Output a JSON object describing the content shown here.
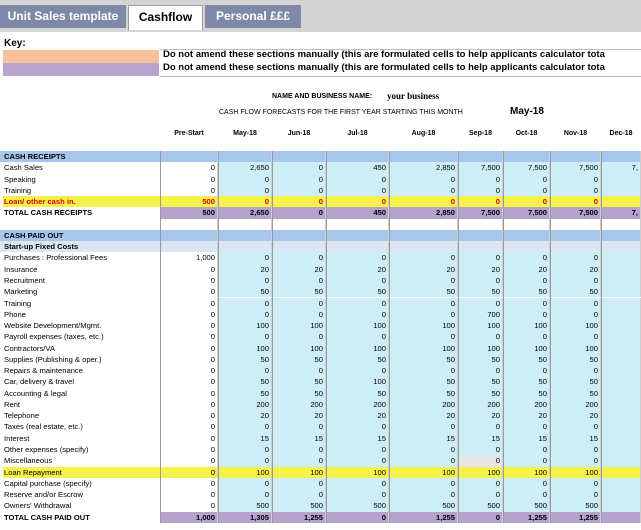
{
  "tabs": [
    {
      "label": "Unit Sales template",
      "state": "inactive"
    },
    {
      "label": "Cashflow",
      "state": "active"
    },
    {
      "label": "Personal £££",
      "state": "inactive"
    }
  ],
  "key": {
    "title": "Key:",
    "items": [
      {
        "color": "#f8c09a",
        "text": "Do not amend these  sections manually (this are formulated cells to help applicants calculator tota"
      },
      {
        "color": "#b7a5cf",
        "text": "Do not amend these  sections manually (this are formulated cells to help applicants calculator tota"
      }
    ]
  },
  "header": {
    "name_label": "NAME AND BUSINESS NAME:",
    "name_value": "your business",
    "forecast_label": "CASH FLOW FORECASTS FOR THE FIRST YEAR STARTING THIS MONTH",
    "start_month": "May-18"
  },
  "columns": [
    "Pre-Start",
    "May-18",
    "Jun-18",
    "Jul-18",
    "Aug-18",
    "Sep-18",
    "Oct-18",
    "Nov-18",
    "Dec-18"
  ],
  "colors": {
    "blue_row": "#a7c6ec",
    "light_blue": "#cdeef7",
    "yellow": "#f7f24a",
    "lavender": "#b5a3ce",
    "pale_blue_header": "#dbe6f3",
    "gray": "#e6e6e6",
    "red_text": "#e00000"
  },
  "rows": [
    {
      "label": "CASH RECEIPTS",
      "style": "section",
      "values": []
    },
    {
      "label": "Cash Sales",
      "style": "data",
      "values": [
        "0",
        "2,650",
        "0",
        "450",
        "2,850",
        "7,500",
        "7,500",
        "7,500",
        "7,"
      ]
    },
    {
      "label": "Speaking",
      "style": "data",
      "values": [
        "0",
        "0",
        "0",
        "0",
        "0",
        "0",
        "0",
        "0",
        ""
      ]
    },
    {
      "label": "Training",
      "style": "data",
      "values": [
        "0",
        "0",
        "0",
        "0",
        "0",
        "0",
        "0",
        "0",
        ""
      ]
    },
    {
      "label": "Loan/ other cash in.",
      "style": "loanin",
      "values": [
        "500",
        "0",
        "0",
        "0",
        "0",
        "0",
        "0",
        "0",
        ""
      ]
    },
    {
      "label": "TOTAL CASH RECEIPTS",
      "style": "total",
      "values": [
        "500",
        "2,650",
        "0",
        "450",
        "2,850",
        "7,500",
        "7,500",
        "7,500",
        "7,"
      ]
    },
    {
      "label": "",
      "style": "spacer",
      "values": []
    },
    {
      "label": "CASH PAID OUT",
      "style": "section",
      "values": []
    },
    {
      "label": "Start-up Fixed Costs",
      "style": "subsection",
      "values": []
    },
    {
      "label": "Purchases : Professional Fees",
      "style": "data",
      "values": [
        "1,000",
        "0",
        "0",
        "0",
        "0",
        "0",
        "0",
        "0",
        ""
      ]
    },
    {
      "label": "Insurance",
      "style": "data",
      "values": [
        "0",
        "20",
        "20",
        "20",
        "20",
        "20",
        "20",
        "20",
        ""
      ]
    },
    {
      "label": "Recruitment",
      "style": "data",
      "values": [
        "0",
        "0",
        "0",
        "0",
        "0",
        "0",
        "0",
        "0",
        ""
      ]
    },
    {
      "label": "Marketing",
      "style": "data",
      "values": [
        "0",
        "50",
        "50",
        "50",
        "50",
        "50",
        "50",
        "50",
        ""
      ]
    },
    {
      "label": "Training",
      "style": "data",
      "values": [
        "0",
        "0",
        "0",
        "0",
        "0",
        "0",
        "0",
        "0",
        ""
      ]
    },
    {
      "label": "Phone",
      "style": "data",
      "values": [
        "0",
        "0",
        "0",
        "0",
        "0",
        "700",
        "0",
        "0",
        ""
      ]
    },
    {
      "label": "Website Development/Mgmt.",
      "style": "data",
      "values": [
        "0",
        "100",
        "100",
        "100",
        "100",
        "100",
        "100",
        "100",
        ""
      ]
    },
    {
      "label": "Payroll expenses (taxes, etc.)",
      "style": "data",
      "values": [
        "0",
        "0",
        "0",
        "0",
        "0",
        "0",
        "0",
        "0",
        ""
      ]
    },
    {
      "label": "Contractors/VA",
      "style": "data",
      "values": [
        "0",
        "100",
        "100",
        "100",
        "100",
        "100",
        "100",
        "100",
        ""
      ]
    },
    {
      "label": "Supplies (Publishing & oper.)",
      "style": "data",
      "values": [
        "0",
        "50",
        "50",
        "50",
        "50",
        "50",
        "50",
        "50",
        ""
      ]
    },
    {
      "label": "Repairs & maintenance",
      "style": "data",
      "values": [
        "0",
        "0",
        "0",
        "0",
        "0",
        "0",
        "0",
        "0",
        ""
      ]
    },
    {
      "label": "Car, delivery & travel",
      "style": "data",
      "values": [
        "0",
        "50",
        "50",
        "100",
        "50",
        "50",
        "50",
        "50",
        ""
      ]
    },
    {
      "label": "Accounting & legal",
      "style": "data",
      "values": [
        "0",
        "50",
        "50",
        "50",
        "50",
        "50",
        "50",
        "50",
        ""
      ]
    },
    {
      "label": "Rent",
      "style": "data",
      "values": [
        "0",
        "200",
        "200",
        "200",
        "200",
        "200",
        "200",
        "200",
        ""
      ]
    },
    {
      "label": "Telephone",
      "style": "data",
      "values": [
        "0",
        "20",
        "20",
        "20",
        "20",
        "20",
        "20",
        "20",
        ""
      ]
    },
    {
      "label": "Taxes (real estate, etc.)",
      "style": "data",
      "values": [
        "0",
        "0",
        "0",
        "0",
        "0",
        "0",
        "0",
        "0",
        ""
      ]
    },
    {
      "label": "Interest",
      "style": "data",
      "values": [
        "0",
        "15",
        "15",
        "15",
        "15",
        "15",
        "15",
        "15",
        ""
      ]
    },
    {
      "label": "Other expenses (specify)",
      "style": "data",
      "values": [
        "0",
        "0",
        "0",
        "0",
        "0",
        "0",
        "0",
        "0",
        ""
      ]
    },
    {
      "label": "Miscellaneous",
      "style": "data",
      "values": [
        "0",
        "0",
        "0",
        "0",
        "0",
        "0",
        "0",
        "0",
        ""
      ]
    },
    {
      "label": "Loan Repayment",
      "style": "loanrepay",
      "values": [
        "0",
        "100",
        "100",
        "100",
        "100",
        "100",
        "100",
        "100",
        ""
      ]
    },
    {
      "label": "Capital purchase (specify)",
      "style": "data",
      "values": [
        "0",
        "0",
        "0",
        "0",
        "0",
        "0",
        "0",
        "0",
        ""
      ]
    },
    {
      "label": "Reserve and/or Escrow",
      "style": "data",
      "values": [
        "0",
        "0",
        "0",
        "0",
        "0",
        "0",
        "0",
        "0",
        ""
      ]
    },
    {
      "label": "Owners' Withdrawal",
      "style": "data",
      "values": [
        "0",
        "500",
        "500",
        "500",
        "500",
        "500",
        "500",
        "500",
        ""
      ]
    },
    {
      "label": "TOTAL CASH PAID OUT",
      "style": "total",
      "values": [
        "1,000",
        "1,305",
        "1,255",
        "0",
        "1,255",
        "0",
        "1,255",
        "1,255",
        ""
      ]
    }
  ]
}
